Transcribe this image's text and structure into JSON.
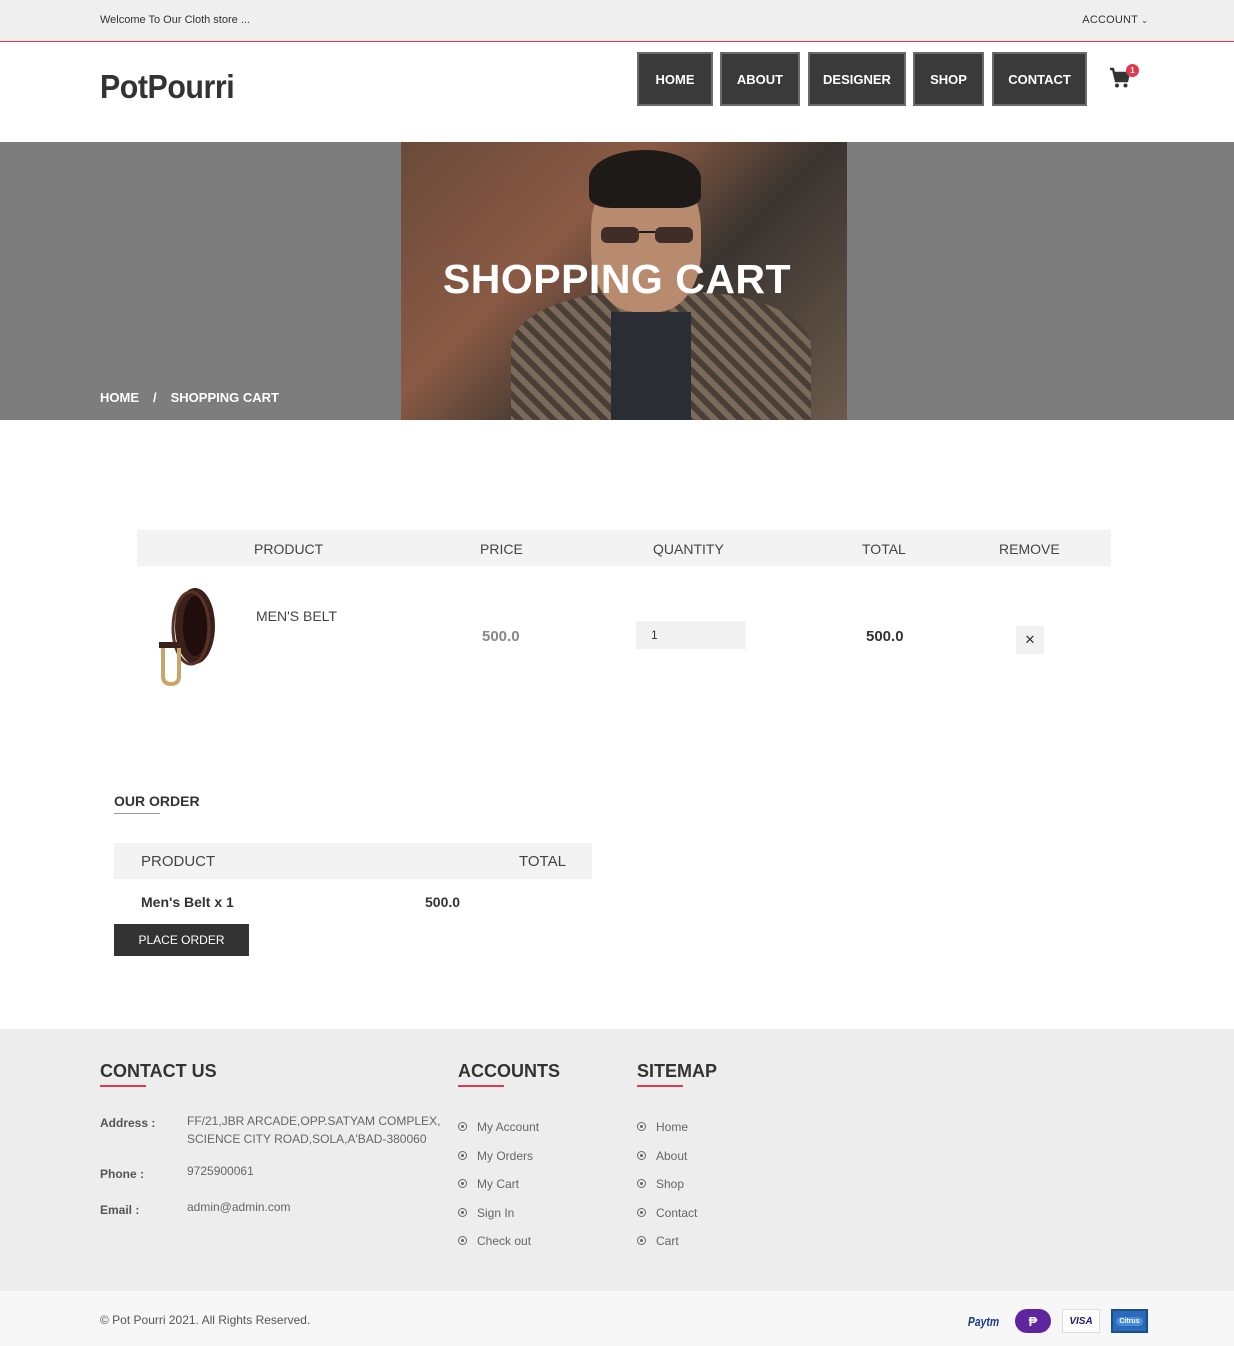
{
  "topbar": {
    "welcome": "Welcome To Our Cloth store ...",
    "account": "ACCOUNT"
  },
  "header": {
    "logo": "PotPourri",
    "nav": [
      "HOME",
      "ABOUT",
      "DESIGNER",
      "SHOP",
      "CONTACT"
    ],
    "cart_count": "1",
    "colors": {
      "nav_bg": "#3a3a3a",
      "accent": "#e03a4e"
    }
  },
  "hero": {
    "title": "SHOPPING CART",
    "breadcrumb": {
      "home": "HOME",
      "separator": "/",
      "current": "SHOPPING CART"
    }
  },
  "cart": {
    "columns": [
      "PRODUCT",
      "PRICE",
      "QUANTITY",
      "TOTAL",
      "REMOVE"
    ],
    "items": [
      {
        "name": "MEN'S BELT",
        "price": "500.0",
        "quantity": "1",
        "total": "500.0",
        "remove": "✕",
        "image_icon": "belt-image"
      }
    ]
  },
  "order": {
    "title": "OUR ORDER",
    "columns": [
      "PRODUCT",
      "TOTAL"
    ],
    "rows": [
      {
        "name": "Men's Belt x 1",
        "total": "500.0"
      }
    ],
    "button": "PLACE ORDER"
  },
  "footer": {
    "contact": {
      "title": "CONTACT US",
      "address_label": "Address :",
      "address_line1": "FF/21,JBR ARCADE,OPP.SATYAM COMPLEX,",
      "address_line2": "SCIENCE CITY ROAD,SOLA,A'BAD-380060",
      "phone_label": "Phone :",
      "phone": "9725900061",
      "email_label": "Email :",
      "email": "admin@admin.com"
    },
    "accounts": {
      "title": "ACCOUNTS",
      "links": [
        "My Account",
        "My Orders",
        "My Cart",
        "Sign In",
        "Check out"
      ]
    },
    "sitemap": {
      "title": "SITEMAP",
      "links": [
        "Home",
        "About",
        "Shop",
        "Contact",
        "Cart"
      ]
    },
    "copyright": "© Pot Pourri 2021. All Rights Reserved.",
    "payments": [
      "Paytm",
      "PhonePe",
      "VISA",
      "Citrus"
    ]
  }
}
